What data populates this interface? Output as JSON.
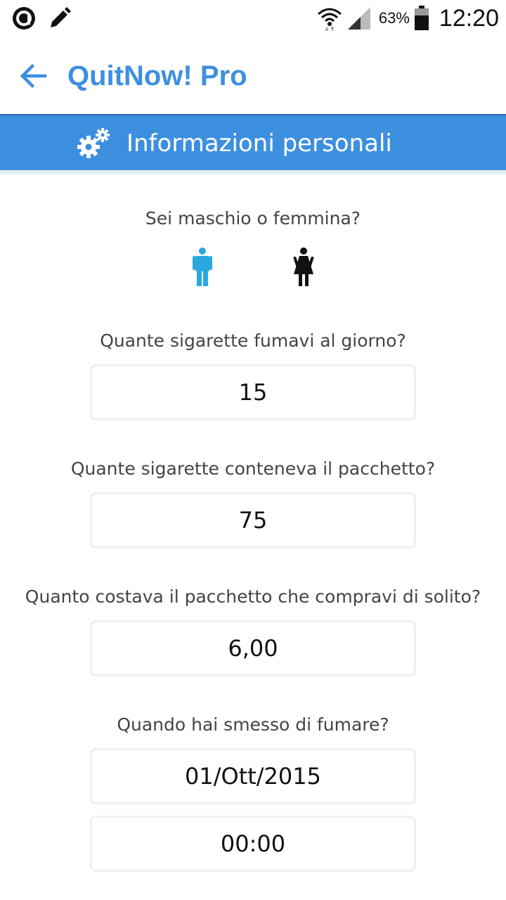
{
  "status_bar": {
    "battery_percent": "63%",
    "time": "12:20"
  },
  "app": {
    "title": "QuitNow! Pro"
  },
  "section": {
    "title": "Informazioni personali"
  },
  "form": {
    "gender_question": "Sei maschio o femmina?",
    "gender_selected": "male",
    "cigarettes_per_day": {
      "label": "Quante sigarette fumavi al giorno?",
      "value": "15"
    },
    "cigarettes_per_pack": {
      "label": "Quante sigarette conteneva il pacchetto?",
      "value": "75"
    },
    "pack_price": {
      "label": "Quanto costava il pacchetto che compravi di solito?",
      "value": "6,00"
    },
    "quit_date": {
      "label": "Quando hai smesso di fumare?",
      "date": "01/Ott/2015",
      "time": "00:00"
    }
  },
  "colors": {
    "accent": "#3d8fe0",
    "male_selected": "#29a8e0",
    "female_unselected": "#111111"
  }
}
